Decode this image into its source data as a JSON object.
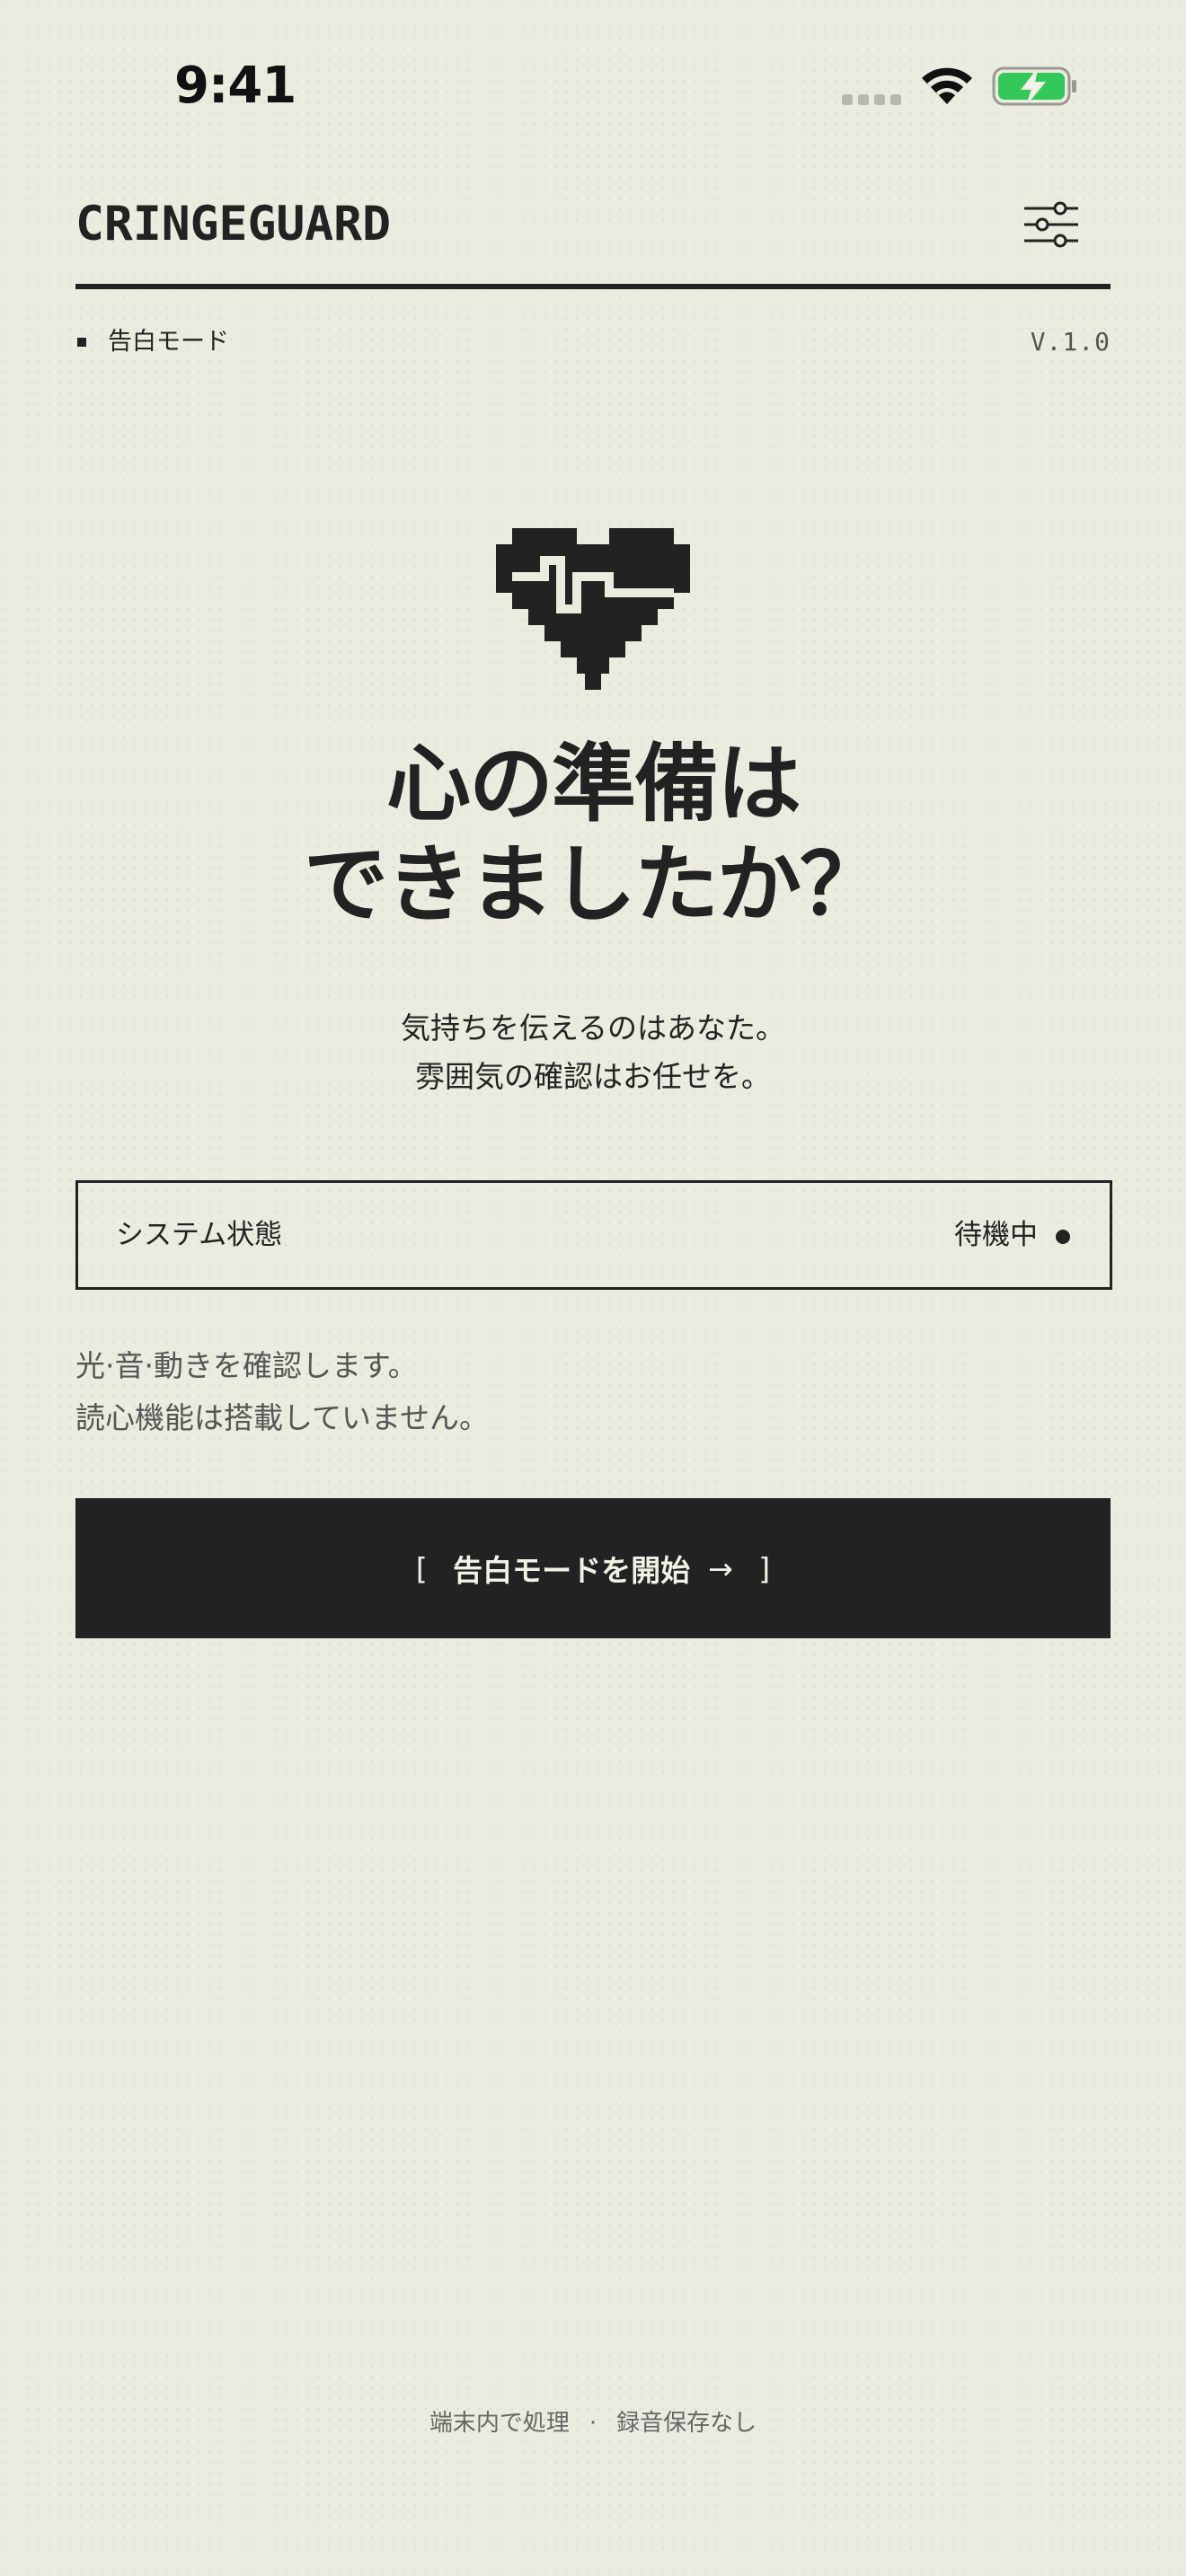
{
  "status_bar": {
    "time": "9:41"
  },
  "header": {
    "brand": "CRINGEGUARD",
    "settings_icon": "sliders-icon",
    "mode_label": "告白モード",
    "version": "V.1.0"
  },
  "hero": {
    "icon": "pixel-heart-pulse-icon",
    "headline_line1": "心の準備は",
    "headline_line2": "できましたか？",
    "sub_line1": "気持ちを伝えるのはあなた。",
    "sub_line2": "雰囲気の確認はお任せを。"
  },
  "system_status": {
    "label": "システム状態",
    "value": "待機中"
  },
  "disclaimer": {
    "line1": "光·音·動きを確認します。",
    "line2": "読心機能は搭載していません。"
  },
  "start_button": {
    "bracket_open": "[",
    "label": "告白モードを開始",
    "arrow": "→",
    "bracket_close": "]"
  },
  "footer": {
    "item1": "端末内で処理",
    "separator": "·",
    "item2": "録音保存なし"
  },
  "colors": {
    "background": "#ebebdf",
    "ink": "#222222",
    "battery_green": "#34c759"
  }
}
